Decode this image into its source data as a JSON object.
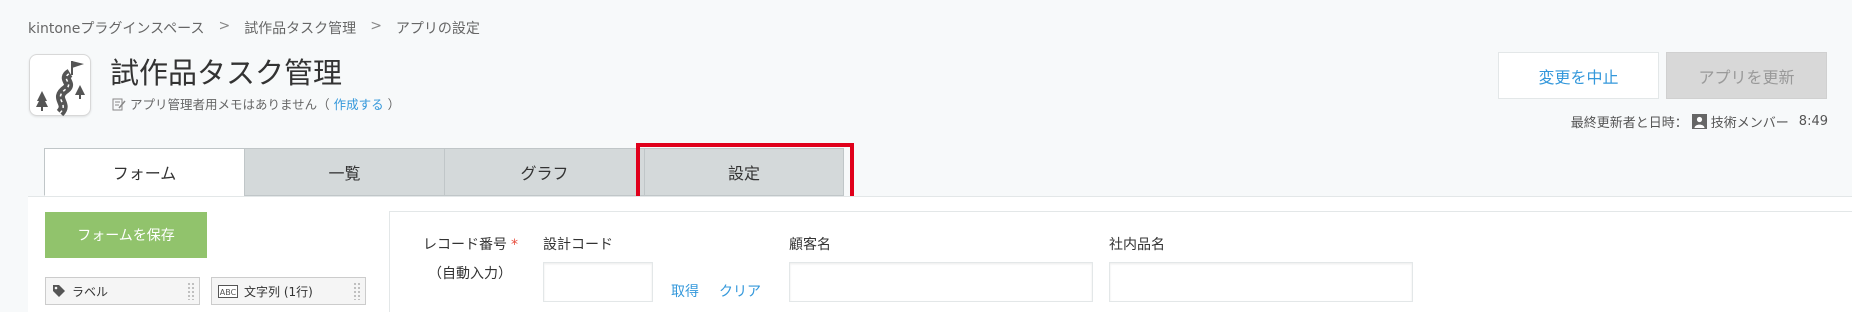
{
  "breadcrumb": {
    "items": [
      "kintoneプラグインスペース",
      "試作品タスク管理",
      "アプリの設定"
    ],
    "separator": ">"
  },
  "app": {
    "title": "試作品タスク管理",
    "memo_text": "アプリ管理者用メモはありません（",
    "memo_link": "作成する",
    "memo_close": "）"
  },
  "actions": {
    "cancel_label": "変更を中止",
    "update_label": "アプリを更新"
  },
  "last_updated": {
    "label": "最終更新者と日時：",
    "user": "技術メンバー",
    "time": "8:49"
  },
  "tabs": [
    {
      "label": "フォーム",
      "active": true
    },
    {
      "label": "一覧",
      "active": false
    },
    {
      "label": "グラフ",
      "active": false
    },
    {
      "label": "設定",
      "active": false,
      "highlighted": true
    }
  ],
  "sidebar": {
    "save_label": "フォームを保存",
    "palette": [
      {
        "label": "ラベル",
        "icon": "tag-icon"
      },
      {
        "label": "文字列 (1行)",
        "icon": "abc-icon"
      }
    ]
  },
  "form": {
    "record_number_label": "レコード番号",
    "required_mark": "*",
    "auto_input": "（自動入力）",
    "design_code_label": "設計コード",
    "fetch_label": "取得",
    "clear_label": "クリア",
    "customer_label": "顧客名",
    "product_label": "社内品名"
  },
  "colors": {
    "accent": "#3498db",
    "save_green": "#91c36c",
    "highlight_red": "#e0001b",
    "required": "#e74c3c"
  }
}
